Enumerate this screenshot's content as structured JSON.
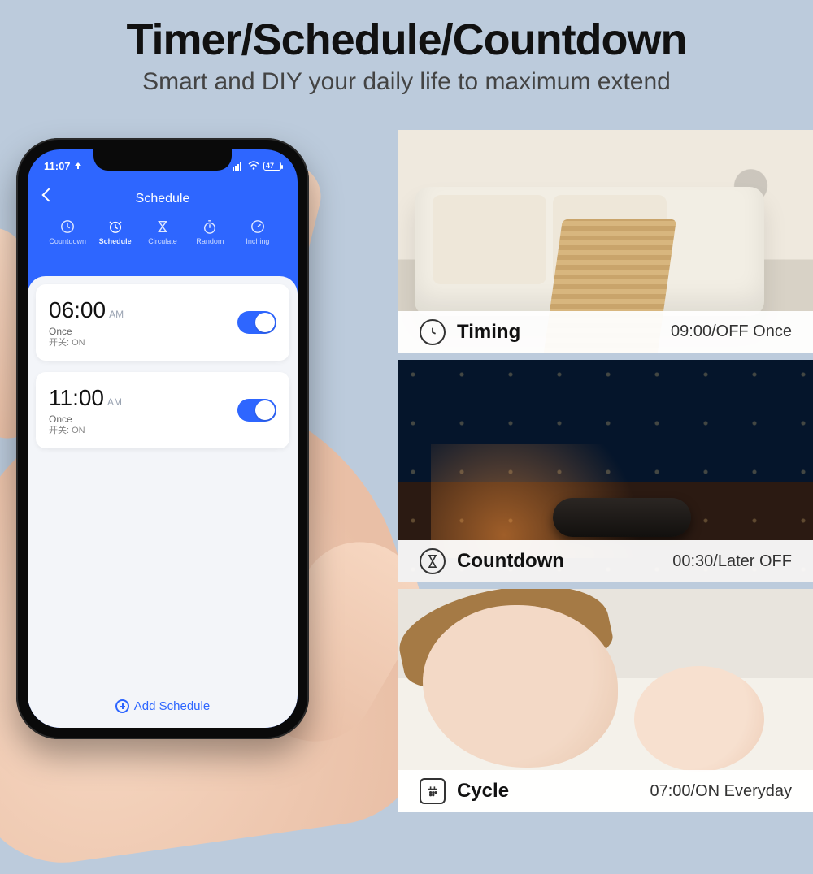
{
  "heading": {
    "title": "Timer/Schedule/Countdown",
    "subtitle": "Smart and DIY your daily life to maximum extend"
  },
  "phone": {
    "status": {
      "time": "11:07",
      "battery": "47"
    },
    "header": {
      "title": "Schedule"
    },
    "tabs": [
      {
        "key": "countdown",
        "label": "Countdown"
      },
      {
        "key": "schedule",
        "label": "Schedule"
      },
      {
        "key": "circulate",
        "label": "Circulate"
      },
      {
        "key": "random",
        "label": "Random"
      },
      {
        "key": "inching",
        "label": "Inching"
      }
    ],
    "active_tab": "schedule",
    "schedules": [
      {
        "time": "06:00",
        "ampm": "AM",
        "repeat": "Once",
        "switch_line": "开关: ON",
        "enabled": true
      },
      {
        "time": "11:00",
        "ampm": "AM",
        "repeat": "Once",
        "switch_line": "开关: ON",
        "enabled": true
      }
    ],
    "add_label": "Add Schedule"
  },
  "panels": [
    {
      "icon": "clock-icon",
      "label": "Timing",
      "desc": "09:00/OFF Once"
    },
    {
      "icon": "hourglass-icon",
      "label": "Countdown",
      "desc": "00:30/Later OFF"
    },
    {
      "icon": "calendar-icon",
      "label": "Cycle",
      "desc": "07:00/ON Everyday"
    }
  ]
}
